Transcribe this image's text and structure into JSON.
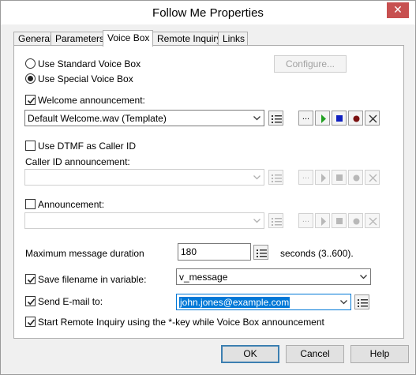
{
  "window": {
    "title": "Follow Me Properties",
    "close_glyph": "✕"
  },
  "tabs": [
    {
      "label": "General"
    },
    {
      "label": "Parameters"
    },
    {
      "label": "Voice Box"
    },
    {
      "label": "Remote Inquiry"
    },
    {
      "label": "Links"
    }
  ],
  "voicebox": {
    "use_standard_label": "Use Standard Voice Box",
    "use_special_label": "Use Special Voice Box",
    "selected_mode": "special",
    "configure_label": "Configure...",
    "welcome_label": "Welcome announcement:",
    "welcome_checked": true,
    "welcome_value": "Default Welcome.wav (Template)",
    "dtmf_label": "Use DTMF as Caller ID",
    "dtmf_checked": false,
    "callerid_label": "Caller ID announcement:",
    "callerid_value": "",
    "announcement_label": "Announcement:",
    "announcement_checked": false,
    "announcement_value": "",
    "browse_label": "...",
    "max_duration_label": "Maximum message duration",
    "max_duration_value": "180",
    "seconds_label": "seconds (3..600).",
    "save_filename_label": "Save filename in variable:",
    "save_filename_checked": true,
    "save_filename_value": "v_message",
    "send_email_label": "Send E-mail to:",
    "send_email_checked": true,
    "send_email_value": "john.jones@example.com",
    "start_remote_label": "Start Remote Inquiry using the *-key while Voice Box announcement",
    "start_remote_checked": true
  },
  "icons": {
    "play": "play-icon",
    "stop": "stop-icon",
    "record": "record-icon",
    "delete": "delete-icon",
    "variable": "variable-list-icon"
  },
  "colors": {
    "play": "#22a022",
    "stop": "#1020c0",
    "record": "#7a1010",
    "default_button_border": "#3c7fb1",
    "selection": "#0078d7"
  },
  "footer": {
    "ok_label": "OK",
    "cancel_label": "Cancel",
    "help_label": "Help"
  }
}
